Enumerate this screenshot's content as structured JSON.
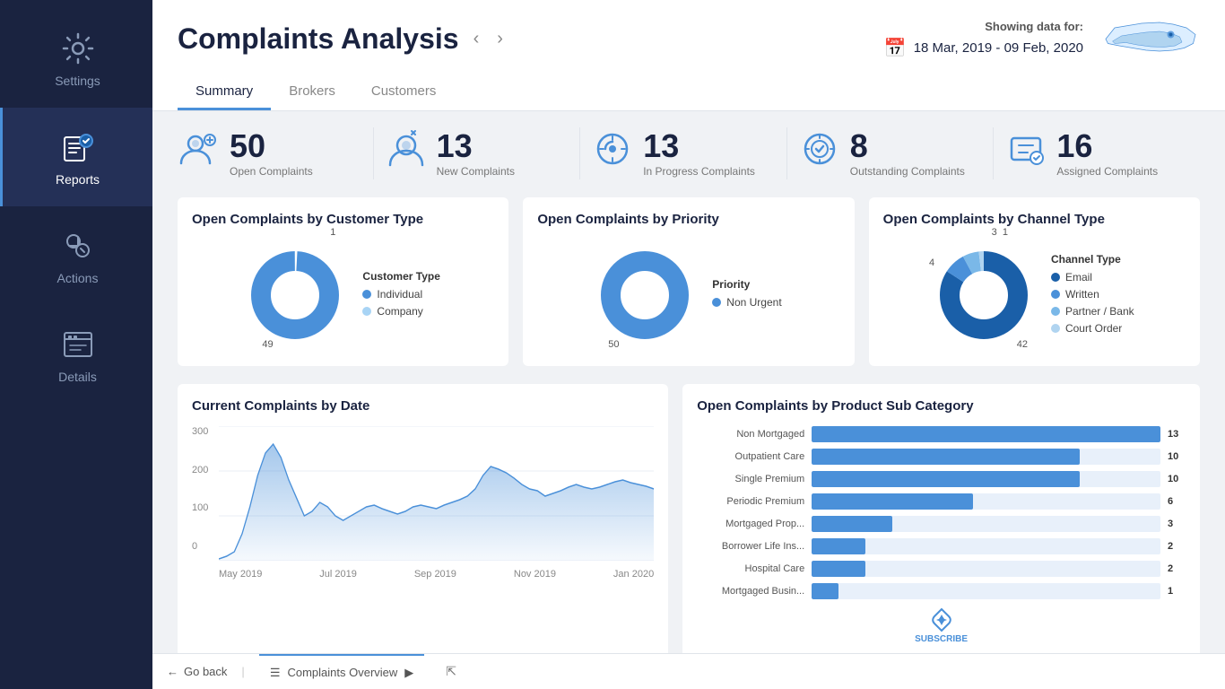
{
  "sidebar": {
    "items": [
      {
        "id": "settings",
        "label": "Settings",
        "icon": "⚙️",
        "active": false
      },
      {
        "id": "reports",
        "label": "Reports",
        "icon": "📊",
        "active": true
      },
      {
        "id": "actions",
        "label": "Actions",
        "icon": "🔧",
        "active": false
      },
      {
        "id": "details",
        "label": "Details",
        "icon": "📋",
        "active": false
      }
    ]
  },
  "header": {
    "title": "Complaints Analysis",
    "showing_label": "Showing data for:",
    "date_range": "18 Mar, 2019 - 09 Feb, 2020",
    "tabs": [
      {
        "id": "summary",
        "label": "Summary",
        "active": true
      },
      {
        "id": "brokers",
        "label": "Brokers",
        "active": false
      },
      {
        "id": "customers",
        "label": "Customers",
        "active": false
      }
    ]
  },
  "stats": [
    {
      "id": "open",
      "number": "50",
      "label": "Open Complaints"
    },
    {
      "id": "new",
      "number": "13",
      "label": "New Complaints"
    },
    {
      "id": "inprogress",
      "number": "13",
      "label": "In Progress Complaints"
    },
    {
      "id": "outstanding",
      "number": "8",
      "label": "Outstanding Complaints"
    },
    {
      "id": "assigned",
      "number": "16",
      "label": "Assigned Complaints"
    }
  ],
  "charts": {
    "customer_type": {
      "title": "Open Complaints by Customer Type",
      "legend_title": "Customer Type",
      "segments": [
        {
          "label": "Individual",
          "value": 49,
          "color": "#4a90d9"
        },
        {
          "label": "Company",
          "value": 1,
          "color": "#a8d4f5"
        }
      ],
      "annotations": [
        {
          "label": "1",
          "position": "top"
        },
        {
          "label": "49",
          "position": "bottom"
        }
      ]
    },
    "priority": {
      "title": "Open Complaints by Priority",
      "legend_title": "Priority",
      "segments": [
        {
          "label": "Non Urgent",
          "value": 50,
          "color": "#4a90d9"
        }
      ],
      "annotations": [
        {
          "label": "50",
          "position": "bottom"
        }
      ]
    },
    "channel_type": {
      "title": "Open Complaints by Channel Type",
      "legend_title": "Channel Type",
      "segments": [
        {
          "label": "Email",
          "value": 42,
          "color": "#1a5fa8"
        },
        {
          "label": "Written",
          "value": 4,
          "color": "#4a90d9"
        },
        {
          "label": "Partner / Bank",
          "value": 3,
          "color": "#7ab8e8"
        },
        {
          "label": "Court Order",
          "value": 1,
          "color": "#b0d4f0"
        }
      ],
      "annotations": [
        {
          "label": "3",
          "position": "top-right"
        },
        {
          "label": "1",
          "position": "top"
        },
        {
          "label": "4",
          "position": "left"
        },
        {
          "label": "42",
          "position": "bottom-right"
        }
      ]
    },
    "by_date": {
      "title": "Current Complaints by Date",
      "y_labels": [
        "300",
        "200",
        "100",
        "0"
      ],
      "x_labels": [
        "May 2019",
        "Jul 2019",
        "Sep 2019",
        "Nov 2019",
        "Jan 2020"
      ]
    },
    "product_sub": {
      "title": "Open Complaints by Product Sub Category",
      "bars": [
        {
          "label": "Non Mortgaged",
          "value": 13,
          "max": 13
        },
        {
          "label": "Outpatient Care",
          "value": 10,
          "max": 13
        },
        {
          "label": "Single Premium",
          "value": 10,
          "max": 13
        },
        {
          "label": "Periodic Premium",
          "value": 6,
          "max": 13
        },
        {
          "label": "Mortgaged Prop...",
          "value": 3,
          "max": 13
        },
        {
          "label": "Borrower Life Ins...",
          "value": 2,
          "max": 13
        },
        {
          "label": "Hospital Care",
          "value": 2,
          "max": 13
        },
        {
          "label": "Mortgaged Busin...",
          "value": 1,
          "max": 13
        }
      ]
    }
  },
  "bottombar": {
    "go_back": "Go back",
    "tab_label": "Complaints Overview",
    "cursor_indicator": "▶"
  },
  "subscribe": {
    "label": "SUBSCRIBE"
  }
}
